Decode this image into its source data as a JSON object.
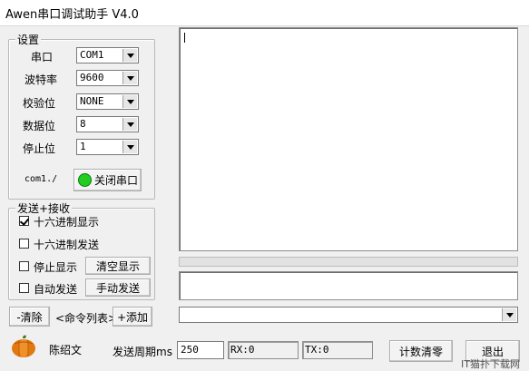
{
  "window": {
    "title": "Awen串口调试助手 V4.0"
  },
  "settings": {
    "legend": "设置",
    "port_label": "串口",
    "port_value": "COM1",
    "baud_label": "波特率",
    "baud_value": "9600",
    "parity_label": "校验位",
    "parity_value": "NONE",
    "databits_label": "数据位",
    "databits_value": "8",
    "stopbits_label": "停止位",
    "stopbits_value": "1",
    "status_text": "com1./",
    "toggle_button": "关闭串口",
    "led_color": "#22cc22"
  },
  "sendrecv": {
    "legend": "发送+接收",
    "hex_display": {
      "label": "十六进制显示",
      "checked": true
    },
    "hex_send": {
      "label": "十六进制发送",
      "checked": false
    },
    "stop_display": {
      "label": "停止显示",
      "checked": false
    },
    "clear_display": "清空显示",
    "auto_send": {
      "label": "自动发送",
      "checked": false
    },
    "manual_send": "手动发送"
  },
  "command": {
    "clear": "-清除",
    "list": "<命令列表>",
    "add": "+添加"
  },
  "footer": {
    "author": "陈绍文",
    "period_label": "发送周期ms",
    "period_value": "250",
    "rx": "RX:0",
    "tx": "TX:0",
    "count_clear": "计数清零",
    "exit": "退出"
  },
  "watermark": "IT猫扑下载网"
}
